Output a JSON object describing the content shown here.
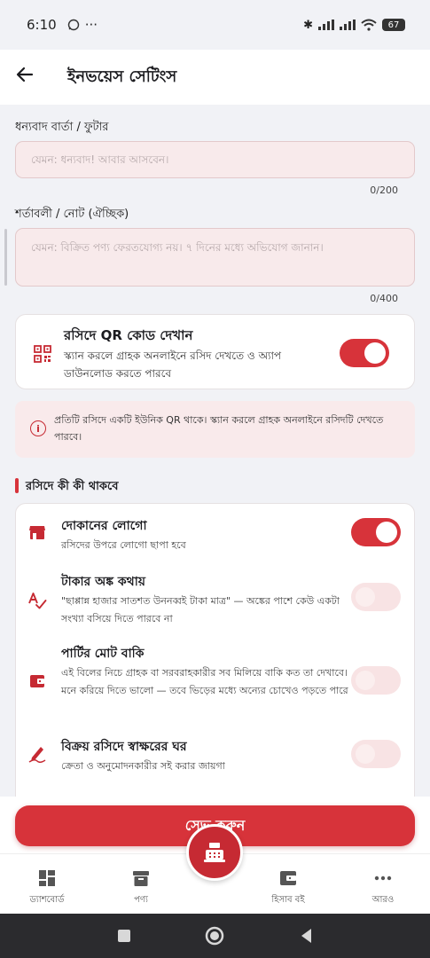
{
  "status_bar": {
    "time": "6:10",
    "battery": "67"
  },
  "app_bar": {
    "title": "ইনভয়েস সেটিংস"
  },
  "thanks_field": {
    "label": "ধন্যবাদ বার্তা / ফুটার",
    "placeholder": "যেমন: ধন্যবাদ! আবার আসবেন।",
    "counter": "0/200"
  },
  "terms_field": {
    "label": "শর্তাবলী / নোট (ঐচ্ছিক)",
    "placeholder": "যেমন: বিক্রিত পণ্য ফেরতযোগ্য নয়। ৭ দিনের মধ্যে অভিযোগ জানান।",
    "counter": "0/400"
  },
  "qr_card": {
    "title": "রসিদে QR কোড দেখান",
    "description": "স্ক্যান করলে গ্রাহক অনলাইনে রসিদ দেখতে ও অ্যাপ ডাউনলোড করতে পারবে",
    "icon": "qr-code-icon",
    "enabled": true
  },
  "info_box": {
    "icon": "info-icon",
    "text": "প্রতিটি রসিদে একটি ইউনিক QR থাকে। স্ক্যান করলে গ্রাহক অনলাইনে রসিদটি দেখতে পারবে।"
  },
  "receipt_section": {
    "title": "রসিদে কী কী থাকবে",
    "items": [
      {
        "title": "দোকানের লোগো",
        "description": "রসিদের উপরে লোগো ছাপা হবে",
        "icon": "store-icon",
        "enabled": true
      },
      {
        "title": "টাকার অঙ্ক কথায়",
        "description": "\"ছাপ্পান্ন হাজার সাতশত উননব্বই টাকা মাত্র\" — অঙ্কের পাশে কেউ একটা সংখ্যা বসিয়ে দিতে পারবে না",
        "icon": "spell-check-icon",
        "enabled": false
      },
      {
        "title": "পার্টির মোট বাকি",
        "description": "এই বিলের নিচে গ্রাহক বা সরবরাহকারীর সব মিলিয়ে বাকি কত তা দেখাবে। মনে করিয়ে দিতে ভালো — তবে ভিড়ের মধ্যে অন্যের চোখেও পড়তে পারে",
        "icon": "wallet-icon",
        "enabled": false
      },
      {
        "title": "বিক্রয় রসিদে স্বাক্ষরের ঘর",
        "description": "ক্রেতা ও অনুমোদনকারীর সই করার জায়গা",
        "icon": "signature-icon",
        "enabled": false
      }
    ]
  },
  "save_button": {
    "label": "সেভ করুন"
  },
  "bottom_nav": {
    "items": [
      {
        "label": "ড্যাশবোর্ড",
        "icon": "dashboard-icon"
      },
      {
        "label": "পণ্য",
        "icon": "archive-box-icon"
      },
      {
        "label": "হিসাব বই",
        "icon": "ledger-wallet-icon"
      },
      {
        "label": "আরও",
        "icon": "more-dots-icon"
      }
    ],
    "fab_icon": "cash-register-icon"
  },
  "colors": {
    "accent": "#d7333a",
    "field_bg": "#f8eaeb",
    "page_bg": "#f1f2f6"
  }
}
